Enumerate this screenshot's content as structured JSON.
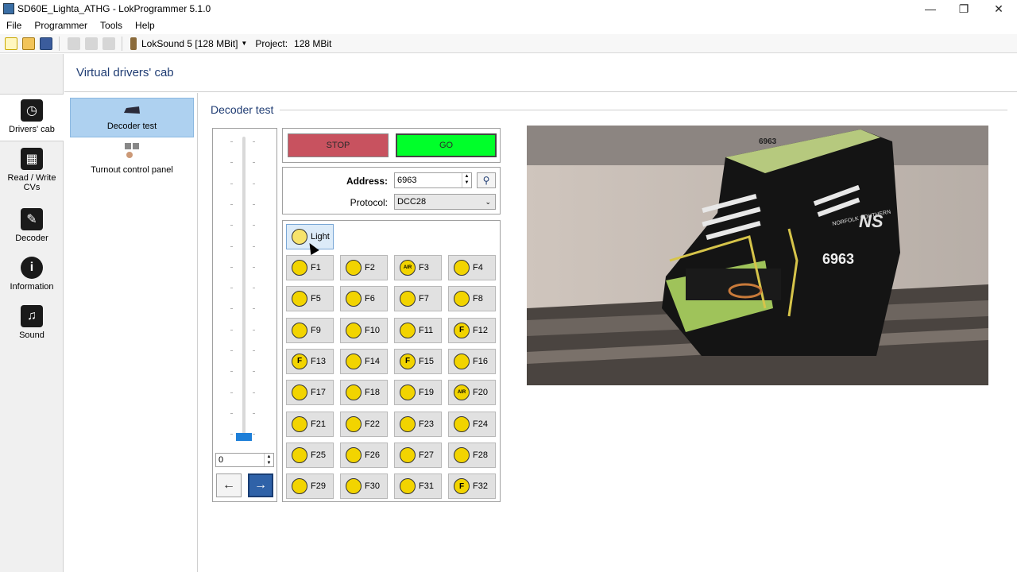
{
  "window": {
    "title": "SD60E_Lighta_ATHG - LokProgrammer 5.1.0",
    "minimize": "—",
    "restore": "❐",
    "close": "✕"
  },
  "menu": [
    "File",
    "Programmer",
    "Tools",
    "Help"
  ],
  "toolbar": {
    "decoder": "LokSound 5 [128 MBit]",
    "project_label": "Project:",
    "project_value": "128 MBit"
  },
  "header": {
    "title": "Virtual drivers' cab"
  },
  "leftnav": [
    {
      "label": "Drivers' cab",
      "icon": "drivers-cab-icon"
    },
    {
      "label": "Read / Write CVs",
      "icon": "cv-icon"
    },
    {
      "label": "Decoder",
      "icon": "wrench-icon"
    },
    {
      "label": "Information",
      "icon": "info-icon"
    },
    {
      "label": "Sound",
      "icon": "music-note-icon"
    }
  ],
  "subnav": [
    {
      "label": "Decoder test",
      "icon": "locomotive-icon"
    },
    {
      "label": "Turnout control panel",
      "icon": "turnout-icon"
    }
  ],
  "section": {
    "title": "Decoder test"
  },
  "throttle": {
    "speed": "0",
    "back": "←",
    "forward": "→"
  },
  "controls": {
    "stop": "STOP",
    "go": "GO"
  },
  "address": {
    "label": "Address:",
    "value": "6963",
    "protocol_label": "Protocol:",
    "protocol_value": "DCC28"
  },
  "functions": {
    "light": "Light",
    "buttons": [
      "F1",
      "F2",
      "F3",
      "F4",
      "F5",
      "F6",
      "F7",
      "F8",
      "F9",
      "F10",
      "F11",
      "F12",
      "F13",
      "F14",
      "F15",
      "F16",
      "F17",
      "F18",
      "F19",
      "F20",
      "F21",
      "F22",
      "F23",
      "F24",
      "F25",
      "F26",
      "F27",
      "F28",
      "F29",
      "F30",
      "F31",
      "F32"
    ]
  },
  "photo": {
    "cab_number": "6963",
    "side_number": "6963",
    "logo": "NS",
    "railroad": "NORFOLK SOUTHERN"
  },
  "colors": {
    "stop": "#c8525f",
    "go": "#00ff2a",
    "accent": "#1f3c73",
    "selected": "#aed1f0",
    "slider": "#1e7fd8"
  }
}
